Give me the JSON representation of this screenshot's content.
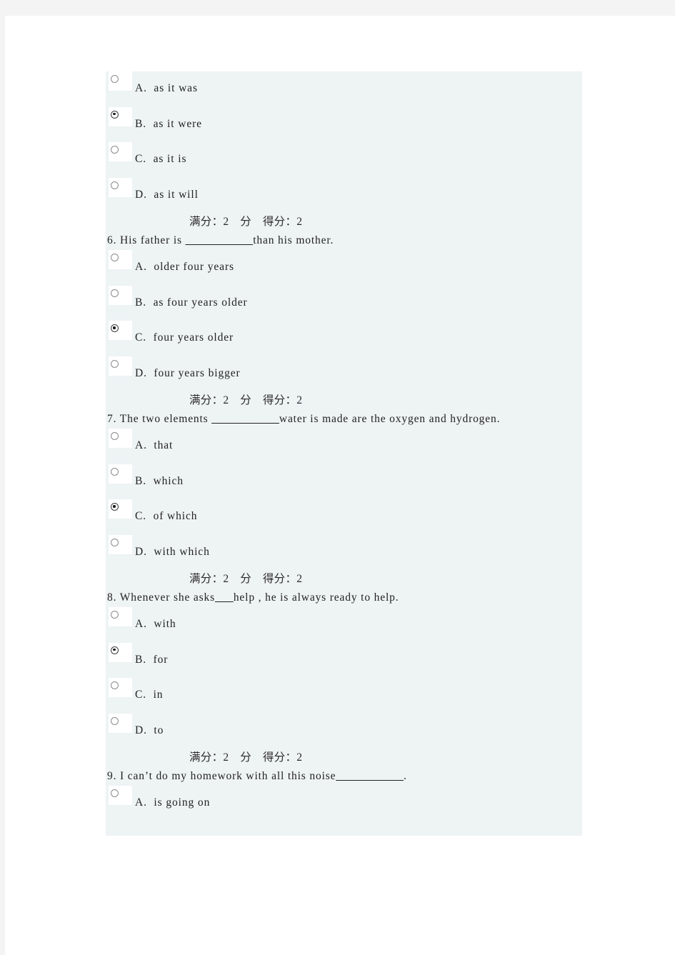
{
  "panel": {
    "background": "#eef3f4"
  },
  "score_line": "满分：2　分　得分：2",
  "blocks": [
    {
      "kind": "options_only",
      "options": [
        {
          "label": "A.  as it was",
          "selected": false
        },
        {
          "label": "B.  as it were",
          "selected": true
        },
        {
          "label": "C.  as it is",
          "selected": false
        },
        {
          "label": "D.  as it will",
          "selected": false
        }
      ]
    },
    {
      "kind": "question",
      "number": "6.",
      "stem_pre": "   His father is ",
      "blank": "___________",
      "stem_post": "than his mother.",
      "options": [
        {
          "label": "A.  older four years",
          "selected": false
        },
        {
          "label": "B.  as four years older",
          "selected": false
        },
        {
          "label": "C.  four years older",
          "selected": true
        },
        {
          "label": "D.  four years bigger",
          "selected": false
        }
      ]
    },
    {
      "kind": "question",
      "number": "7.",
      "stem_pre": "   The two elements ",
      "blank": "___________",
      "stem_post": "water is made are the oxygen and hydrogen.",
      "options": [
        {
          "label": "A.  that",
          "selected": false
        },
        {
          "label": "B.  which",
          "selected": false
        },
        {
          "label": "C.  of which",
          "selected": true
        },
        {
          "label": "D.  with which",
          "selected": false
        }
      ]
    },
    {
      "kind": "question",
      "number": "8.",
      "stem_pre": "   Whenever she asks",
      "blank": "___",
      "stem_post": "help , he is always ready to help.",
      "options": [
        {
          "label": "A.  with",
          "selected": false
        },
        {
          "label": "B.  for",
          "selected": true
        },
        {
          "label": "C.  in",
          "selected": false
        },
        {
          "label": "D.  to",
          "selected": false
        }
      ]
    },
    {
      "kind": "question",
      "number": "9.",
      "stem_pre": "   I can’t do my homework with all this noise",
      "blank": "___________",
      "stem_post": ".",
      "options": [
        {
          "label": "A.  is going on",
          "selected": false
        }
      ]
    }
  ]
}
